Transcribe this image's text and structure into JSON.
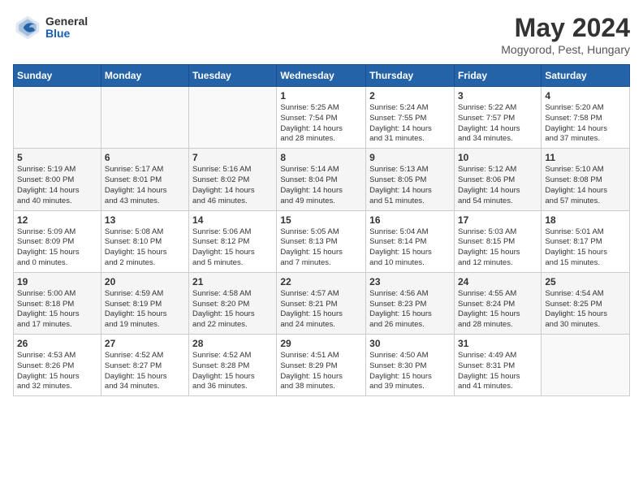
{
  "header": {
    "logo_general": "General",
    "logo_blue": "Blue",
    "month_title": "May 2024",
    "location": "Mogyorod, Pest, Hungary"
  },
  "weekdays": [
    "Sunday",
    "Monday",
    "Tuesday",
    "Wednesday",
    "Thursday",
    "Friday",
    "Saturday"
  ],
  "weeks": [
    [
      {
        "day": "",
        "info": ""
      },
      {
        "day": "",
        "info": ""
      },
      {
        "day": "",
        "info": ""
      },
      {
        "day": "1",
        "info": "Sunrise: 5:25 AM\nSunset: 7:54 PM\nDaylight: 14 hours\nand 28 minutes."
      },
      {
        "day": "2",
        "info": "Sunrise: 5:24 AM\nSunset: 7:55 PM\nDaylight: 14 hours\nand 31 minutes."
      },
      {
        "day": "3",
        "info": "Sunrise: 5:22 AM\nSunset: 7:57 PM\nDaylight: 14 hours\nand 34 minutes."
      },
      {
        "day": "4",
        "info": "Sunrise: 5:20 AM\nSunset: 7:58 PM\nDaylight: 14 hours\nand 37 minutes."
      }
    ],
    [
      {
        "day": "5",
        "info": "Sunrise: 5:19 AM\nSunset: 8:00 PM\nDaylight: 14 hours\nand 40 minutes."
      },
      {
        "day": "6",
        "info": "Sunrise: 5:17 AM\nSunset: 8:01 PM\nDaylight: 14 hours\nand 43 minutes."
      },
      {
        "day": "7",
        "info": "Sunrise: 5:16 AM\nSunset: 8:02 PM\nDaylight: 14 hours\nand 46 minutes."
      },
      {
        "day": "8",
        "info": "Sunrise: 5:14 AM\nSunset: 8:04 PM\nDaylight: 14 hours\nand 49 minutes."
      },
      {
        "day": "9",
        "info": "Sunrise: 5:13 AM\nSunset: 8:05 PM\nDaylight: 14 hours\nand 51 minutes."
      },
      {
        "day": "10",
        "info": "Sunrise: 5:12 AM\nSunset: 8:06 PM\nDaylight: 14 hours\nand 54 minutes."
      },
      {
        "day": "11",
        "info": "Sunrise: 5:10 AM\nSunset: 8:08 PM\nDaylight: 14 hours\nand 57 minutes."
      }
    ],
    [
      {
        "day": "12",
        "info": "Sunrise: 5:09 AM\nSunset: 8:09 PM\nDaylight: 15 hours\nand 0 minutes."
      },
      {
        "day": "13",
        "info": "Sunrise: 5:08 AM\nSunset: 8:10 PM\nDaylight: 15 hours\nand 2 minutes."
      },
      {
        "day": "14",
        "info": "Sunrise: 5:06 AM\nSunset: 8:12 PM\nDaylight: 15 hours\nand 5 minutes."
      },
      {
        "day": "15",
        "info": "Sunrise: 5:05 AM\nSunset: 8:13 PM\nDaylight: 15 hours\nand 7 minutes."
      },
      {
        "day": "16",
        "info": "Sunrise: 5:04 AM\nSunset: 8:14 PM\nDaylight: 15 hours\nand 10 minutes."
      },
      {
        "day": "17",
        "info": "Sunrise: 5:03 AM\nSunset: 8:15 PM\nDaylight: 15 hours\nand 12 minutes."
      },
      {
        "day": "18",
        "info": "Sunrise: 5:01 AM\nSunset: 8:17 PM\nDaylight: 15 hours\nand 15 minutes."
      }
    ],
    [
      {
        "day": "19",
        "info": "Sunrise: 5:00 AM\nSunset: 8:18 PM\nDaylight: 15 hours\nand 17 minutes."
      },
      {
        "day": "20",
        "info": "Sunrise: 4:59 AM\nSunset: 8:19 PM\nDaylight: 15 hours\nand 19 minutes."
      },
      {
        "day": "21",
        "info": "Sunrise: 4:58 AM\nSunset: 8:20 PM\nDaylight: 15 hours\nand 22 minutes."
      },
      {
        "day": "22",
        "info": "Sunrise: 4:57 AM\nSunset: 8:21 PM\nDaylight: 15 hours\nand 24 minutes."
      },
      {
        "day": "23",
        "info": "Sunrise: 4:56 AM\nSunset: 8:23 PM\nDaylight: 15 hours\nand 26 minutes."
      },
      {
        "day": "24",
        "info": "Sunrise: 4:55 AM\nSunset: 8:24 PM\nDaylight: 15 hours\nand 28 minutes."
      },
      {
        "day": "25",
        "info": "Sunrise: 4:54 AM\nSunset: 8:25 PM\nDaylight: 15 hours\nand 30 minutes."
      }
    ],
    [
      {
        "day": "26",
        "info": "Sunrise: 4:53 AM\nSunset: 8:26 PM\nDaylight: 15 hours\nand 32 minutes."
      },
      {
        "day": "27",
        "info": "Sunrise: 4:52 AM\nSunset: 8:27 PM\nDaylight: 15 hours\nand 34 minutes."
      },
      {
        "day": "28",
        "info": "Sunrise: 4:52 AM\nSunset: 8:28 PM\nDaylight: 15 hours\nand 36 minutes."
      },
      {
        "day": "29",
        "info": "Sunrise: 4:51 AM\nSunset: 8:29 PM\nDaylight: 15 hours\nand 38 minutes."
      },
      {
        "day": "30",
        "info": "Sunrise: 4:50 AM\nSunset: 8:30 PM\nDaylight: 15 hours\nand 39 minutes."
      },
      {
        "day": "31",
        "info": "Sunrise: 4:49 AM\nSunset: 8:31 PM\nDaylight: 15 hours\nand 41 minutes."
      },
      {
        "day": "",
        "info": ""
      }
    ]
  ]
}
